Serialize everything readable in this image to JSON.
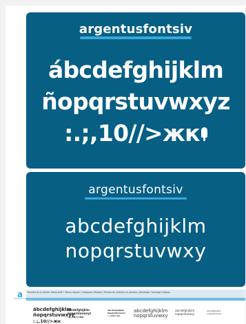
{
  "bold_panel": {
    "title": "argentusfontsiv",
    "line1": "ábcdefghijklm",
    "line2": "ñopqrstuvwxyz",
    "line3": ":.;,10//>жк"
  },
  "light_panel": {
    "title": "argentusfontsiv",
    "line1": "abcdefghijklm",
    "line2": "nopqrstuvwxy"
  },
  "footer": {
    "meta": "Nombre de la fuente: Maxia bold • Marca regular  |  Categoría: Display  |  Período de creación en proceso  |  Diseñador: Santiago Gustavo",
    "logo_mark": "a",
    "logo_caption": "ARGENTUS FONT",
    "samples_bold_large": [
      "ábcdefghijklm",
      "ñopqrstuvwxyz",
      ":.;,10//>жк"
    ],
    "samples_bold_medium": [
      "abcdefghijklm",
      "ñopqrstuvwxyz",
      ":.;,10//>жк"
    ],
    "samples_bold_small": [
      "abcdefghijklm",
      "ñopqrstuvwxyz",
      ":.;,10//>жк"
    ],
    "samples_light_large": [
      "abcdefghijklm",
      "nopqrstuvwxy"
    ],
    "samples_light_medium": [
      "abcdefghijklm",
      "nopqrstuvwxy"
    ],
    "samples_light_small": [
      "abcdefghijklm",
      "nopqrstuvwxy"
    ]
  },
  "colors": {
    "panel": "#075f84",
    "accent": "#39a8db",
    "text": "#ffffff"
  }
}
